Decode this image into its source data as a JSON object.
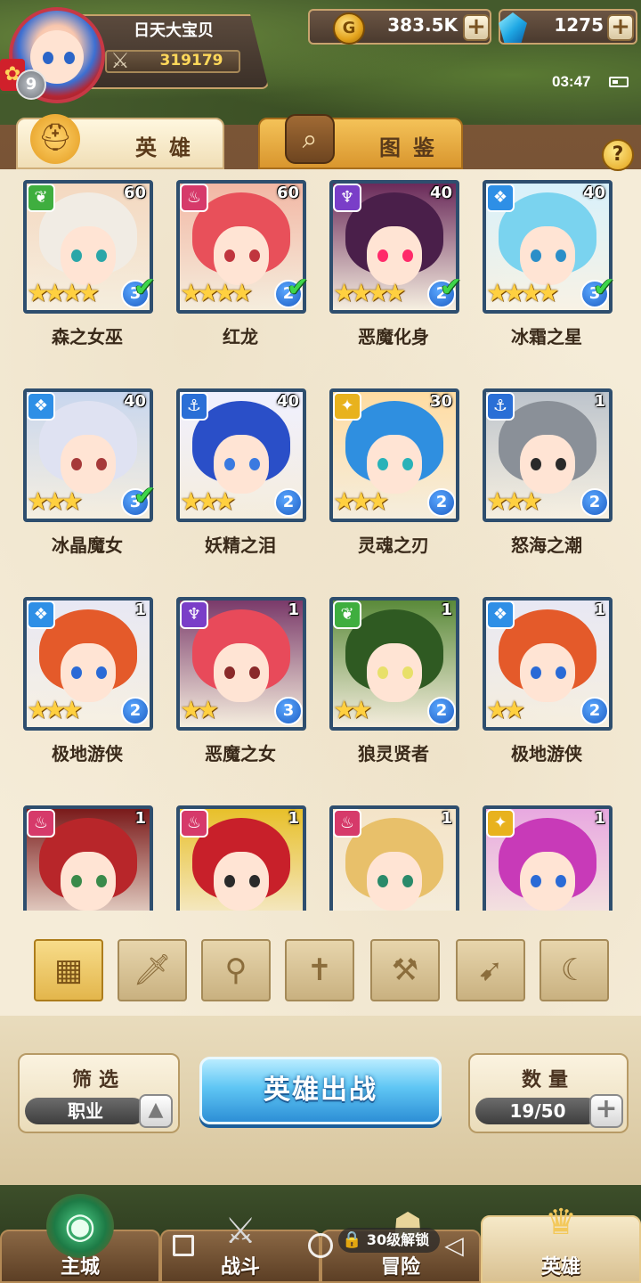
{
  "player": {
    "name": "日天大宝贝",
    "power": "319179",
    "level": "9"
  },
  "resources": {
    "gold": "383.5K",
    "gems": "1275"
  },
  "status": {
    "time": "03:47"
  },
  "tabs": {
    "heroes": "英雄",
    "codex": "图鉴"
  },
  "help_label": "?",
  "heroes": [
    {
      "name": "森之女巫",
      "level": "60",
      "stars": "★★★★",
      "count": "3",
      "faction": "nature",
      "faction_color": "#3fae3f",
      "hair": "#f1ece4",
      "eye": "#2aa6a8",
      "bg": "#f4d8c0",
      "ready": true
    },
    {
      "name": "红龙",
      "level": "60",
      "stars": "★★★★",
      "count": "2",
      "faction": "fire",
      "faction_color": "#d63a6a",
      "hair": "#e8505a",
      "eye": "#c0353e",
      "bg": "#f2b7a4",
      "ready": true
    },
    {
      "name": "恶魔化身",
      "level": "40",
      "stars": "★★★★",
      "count": "2",
      "faction": "demon",
      "faction_color": "#7a3ec8",
      "hair": "#4a1f4a",
      "eye": "#ff2a6a",
      "bg": "#6a2a5a",
      "ready": true
    },
    {
      "name": "冰霜之星",
      "level": "40",
      "stars": "★★★★",
      "count": "3",
      "faction": "ice",
      "faction_color": "#2e8fe6",
      "hair": "#7ad3ef",
      "eye": "#2a8ec8",
      "bg": "#d8f1fb",
      "ready": true
    },
    {
      "name": "冰晶魔女",
      "level": "40",
      "stars": "★★★",
      "count": "3",
      "faction": "ice",
      "faction_color": "#2e8fe6",
      "hair": "#dfe2f2",
      "eye": "#a63a3a",
      "bg": "#c8d6ee",
      "ready": true
    },
    {
      "name": "妖精之泪",
      "level": "40",
      "stars": "★★★",
      "count": "2",
      "faction": "sea",
      "faction_color": "#2a6fd6",
      "hair": "#2a4fc8",
      "eye": "#3a7ae0",
      "bg": "#f0f0ff",
      "ready": false
    },
    {
      "name": "灵魂之刃",
      "level": "30",
      "stars": "★★★",
      "count": "2",
      "faction": "light",
      "faction_color": "#e8b21e",
      "hair": "#2f8fe0",
      "eye": "#28b2b8",
      "bg": "#ffdca2",
      "ready": false
    },
    {
      "name": "怒海之潮",
      "level": "1",
      "stars": "★★★",
      "count": "2",
      "faction": "sea",
      "faction_color": "#2a6fd6",
      "hair": "#8a9098",
      "eye": "#2a2a2a",
      "bg": "#bdc4cc",
      "ready": false
    },
    {
      "name": "极地游侠",
      "level": "1",
      "stars": "★★★",
      "count": "2",
      "faction": "ice",
      "faction_color": "#2e8fe6",
      "hair": "#e45a2a",
      "eye": "#2a6ad6",
      "bg": "#e8e8f4",
      "ready": false
    },
    {
      "name": "恶魔之女",
      "level": "1",
      "stars": "★★",
      "count": "3",
      "faction": "demon",
      "faction_color": "#7a3ec8",
      "hair": "#e84a5a",
      "eye": "#8a2a2a",
      "bg": "#7a3a6a",
      "ready": false
    },
    {
      "name": "狼灵贤者",
      "level": "1",
      "stars": "★★",
      "count": "2",
      "faction": "nature",
      "faction_color": "#3fae3f",
      "hair": "#2f5a22",
      "eye": "#e8e06a",
      "bg": "#5a8a3a",
      "ready": false
    },
    {
      "name": "极地游侠",
      "level": "1",
      "stars": "★★",
      "count": "2",
      "faction": "ice",
      "faction_color": "#2e8fe6",
      "hair": "#e45a2a",
      "eye": "#2a6ad6",
      "bg": "#e8e8f4",
      "ready": false
    },
    {
      "name": "",
      "level": "1",
      "stars": "",
      "count": "",
      "faction": "fire",
      "faction_color": "#d63a6a",
      "hair": "#b8262a",
      "eye": "#3a8a4a",
      "bg": "#7a1a1a",
      "ready": false
    },
    {
      "name": "",
      "level": "1",
      "stars": "",
      "count": "",
      "faction": "fire",
      "faction_color": "#d63a6a",
      "hair": "#c8202a",
      "eye": "#2a2a2a",
      "bg": "#e8c02a",
      "ready": false
    },
    {
      "name": "",
      "level": "1",
      "stars": "",
      "count": "",
      "faction": "fire",
      "faction_color": "#d63a6a",
      "hair": "#e8c06a",
      "eye": "#2a8a6a",
      "bg": "#f4e4c8",
      "ready": false
    },
    {
      "name": "",
      "level": "1",
      "stars": "",
      "count": "",
      "faction": "light",
      "faction_color": "#e8b21e",
      "hair": "#c83ab8",
      "eye": "#2a6ad6",
      "bg": "#e8a8e0",
      "ready": false
    }
  ],
  "class_filters": [
    {
      "id": "all",
      "icon": "grid-icon",
      "active": true
    },
    {
      "id": "warrior",
      "icon": "sword-icon",
      "active": false
    },
    {
      "id": "mage",
      "icon": "staff-icon",
      "active": false
    },
    {
      "id": "priest",
      "icon": "cross-icon",
      "active": false
    },
    {
      "id": "tank",
      "icon": "axe-icon",
      "active": false
    },
    {
      "id": "archer",
      "icon": "bow-icon",
      "active": false
    },
    {
      "id": "assassin",
      "icon": "dagger-icon",
      "active": false
    }
  ],
  "controls": {
    "filter_label": "筛选",
    "filter_value": "职业",
    "deploy_label": "英雄出战",
    "count_label": "数量",
    "count_value": "19/50"
  },
  "nav": {
    "city": "主城",
    "battle": "战斗",
    "adventure": "冒险",
    "heroes": "英雄",
    "lock_text": "30级解锁"
  }
}
